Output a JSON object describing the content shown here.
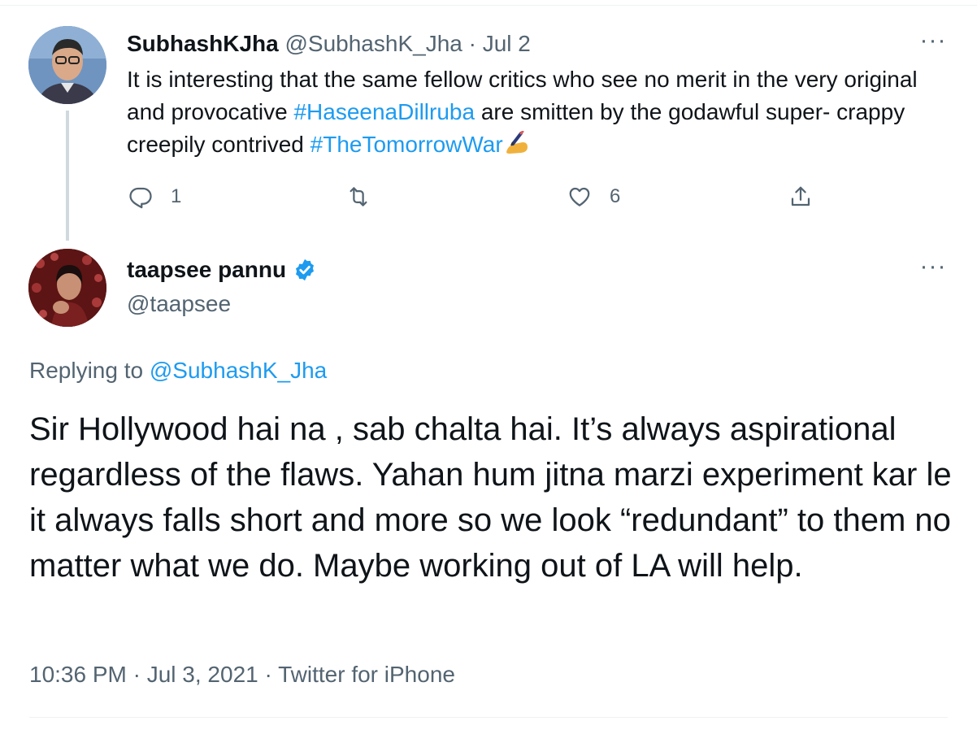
{
  "reply_parent": {
    "display_name": "SubhashKJha",
    "handle_and_date": "@SubhashK_Jha · Jul 2",
    "text_1": "It is interesting that the same fellow critics who see no merit in the very original and provocative ",
    "hashtag_1": "#HaseenaDillruba",
    "text_2": " are smitten by the godawful super- crappy creepily contrived ",
    "hashtag_2": "#TheTomorrowWar",
    "emoji_icon": "writing-hand-emoji",
    "more_icon": "more-horizontal-icon",
    "reply_count": "1",
    "retweet_count": "",
    "like_count": "6"
  },
  "tweet": {
    "display_name": "taapsee pannu",
    "verified_icon": "verified-badge-icon",
    "handle": "@taapsee",
    "replying_prefix": "Replying to ",
    "replying_mention": "@SubhashK_Jha",
    "body": "Sir Hollywood hai na , sab chalta hai. It’s always aspirational regardless of the flaws. Yahan hum jitna marzi experiment kar le it always falls short and more so we look “redundant” to them no matter what we do. Maybe working out of LA will help.",
    "footer": "10:36 PM · Jul 3, 2021 · Twitter for iPhone"
  },
  "colors": {
    "link": "#1d9bf0",
    "secondary_text": "#536471",
    "primary_text": "#0f1419",
    "thread_line": "#cfd9de"
  }
}
